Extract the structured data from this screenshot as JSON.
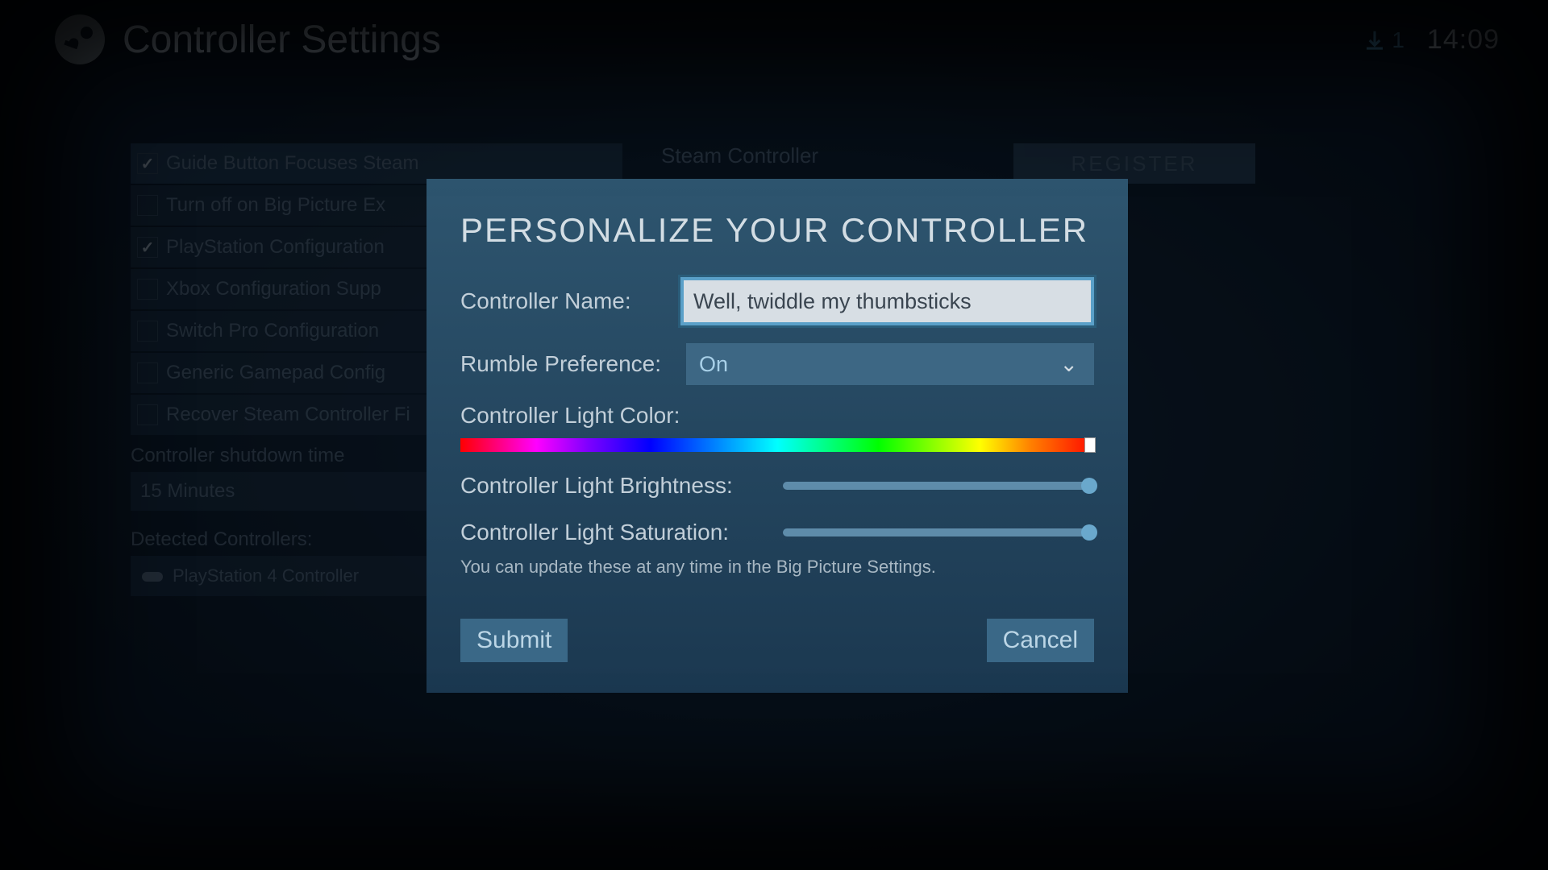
{
  "header": {
    "title": "Controller Settings",
    "download_count": "1",
    "clock": "14:09"
  },
  "background": {
    "checks": [
      {
        "label": "Guide Button Focuses Steam",
        "checked": true,
        "selected": true
      },
      {
        "label": "Turn off on Big Picture Ex",
        "checked": false,
        "selected": false
      },
      {
        "label": "PlayStation Configuration",
        "checked": true,
        "selected": false
      },
      {
        "label": "Xbox Configuration Supp",
        "checked": false,
        "selected": false
      },
      {
        "label": "Switch Pro Configuration",
        "checked": false,
        "selected": false
      },
      {
        "label": "Generic Gamepad Config",
        "checked": false,
        "selected": false
      },
      {
        "label": "Recover Steam Controller Fi",
        "checked": false,
        "selected": false
      }
    ],
    "shutdown_label": "Controller shutdown time",
    "shutdown_value": "15 Minutes",
    "detected_label": "Detected Controllers:",
    "detected_controller": "PlayStation 4 Controller",
    "right_title": "Steam Controller",
    "register_button": "REGISTER"
  },
  "modal": {
    "title": "PERSONALIZE YOUR CONTROLLER",
    "name_label": "Controller Name:",
    "name_value": "Well, twiddle my thumbsticks",
    "rumble_label": "Rumble Preference:",
    "rumble_value": "On",
    "color_label": "Controller Light Color:",
    "brightness_label": "Controller Light Brightness:",
    "saturation_label": "Controller Light Saturation:",
    "hint": "You can update these at any time in the Big Picture Settings.",
    "submit": "Submit",
    "cancel": "Cancel"
  }
}
